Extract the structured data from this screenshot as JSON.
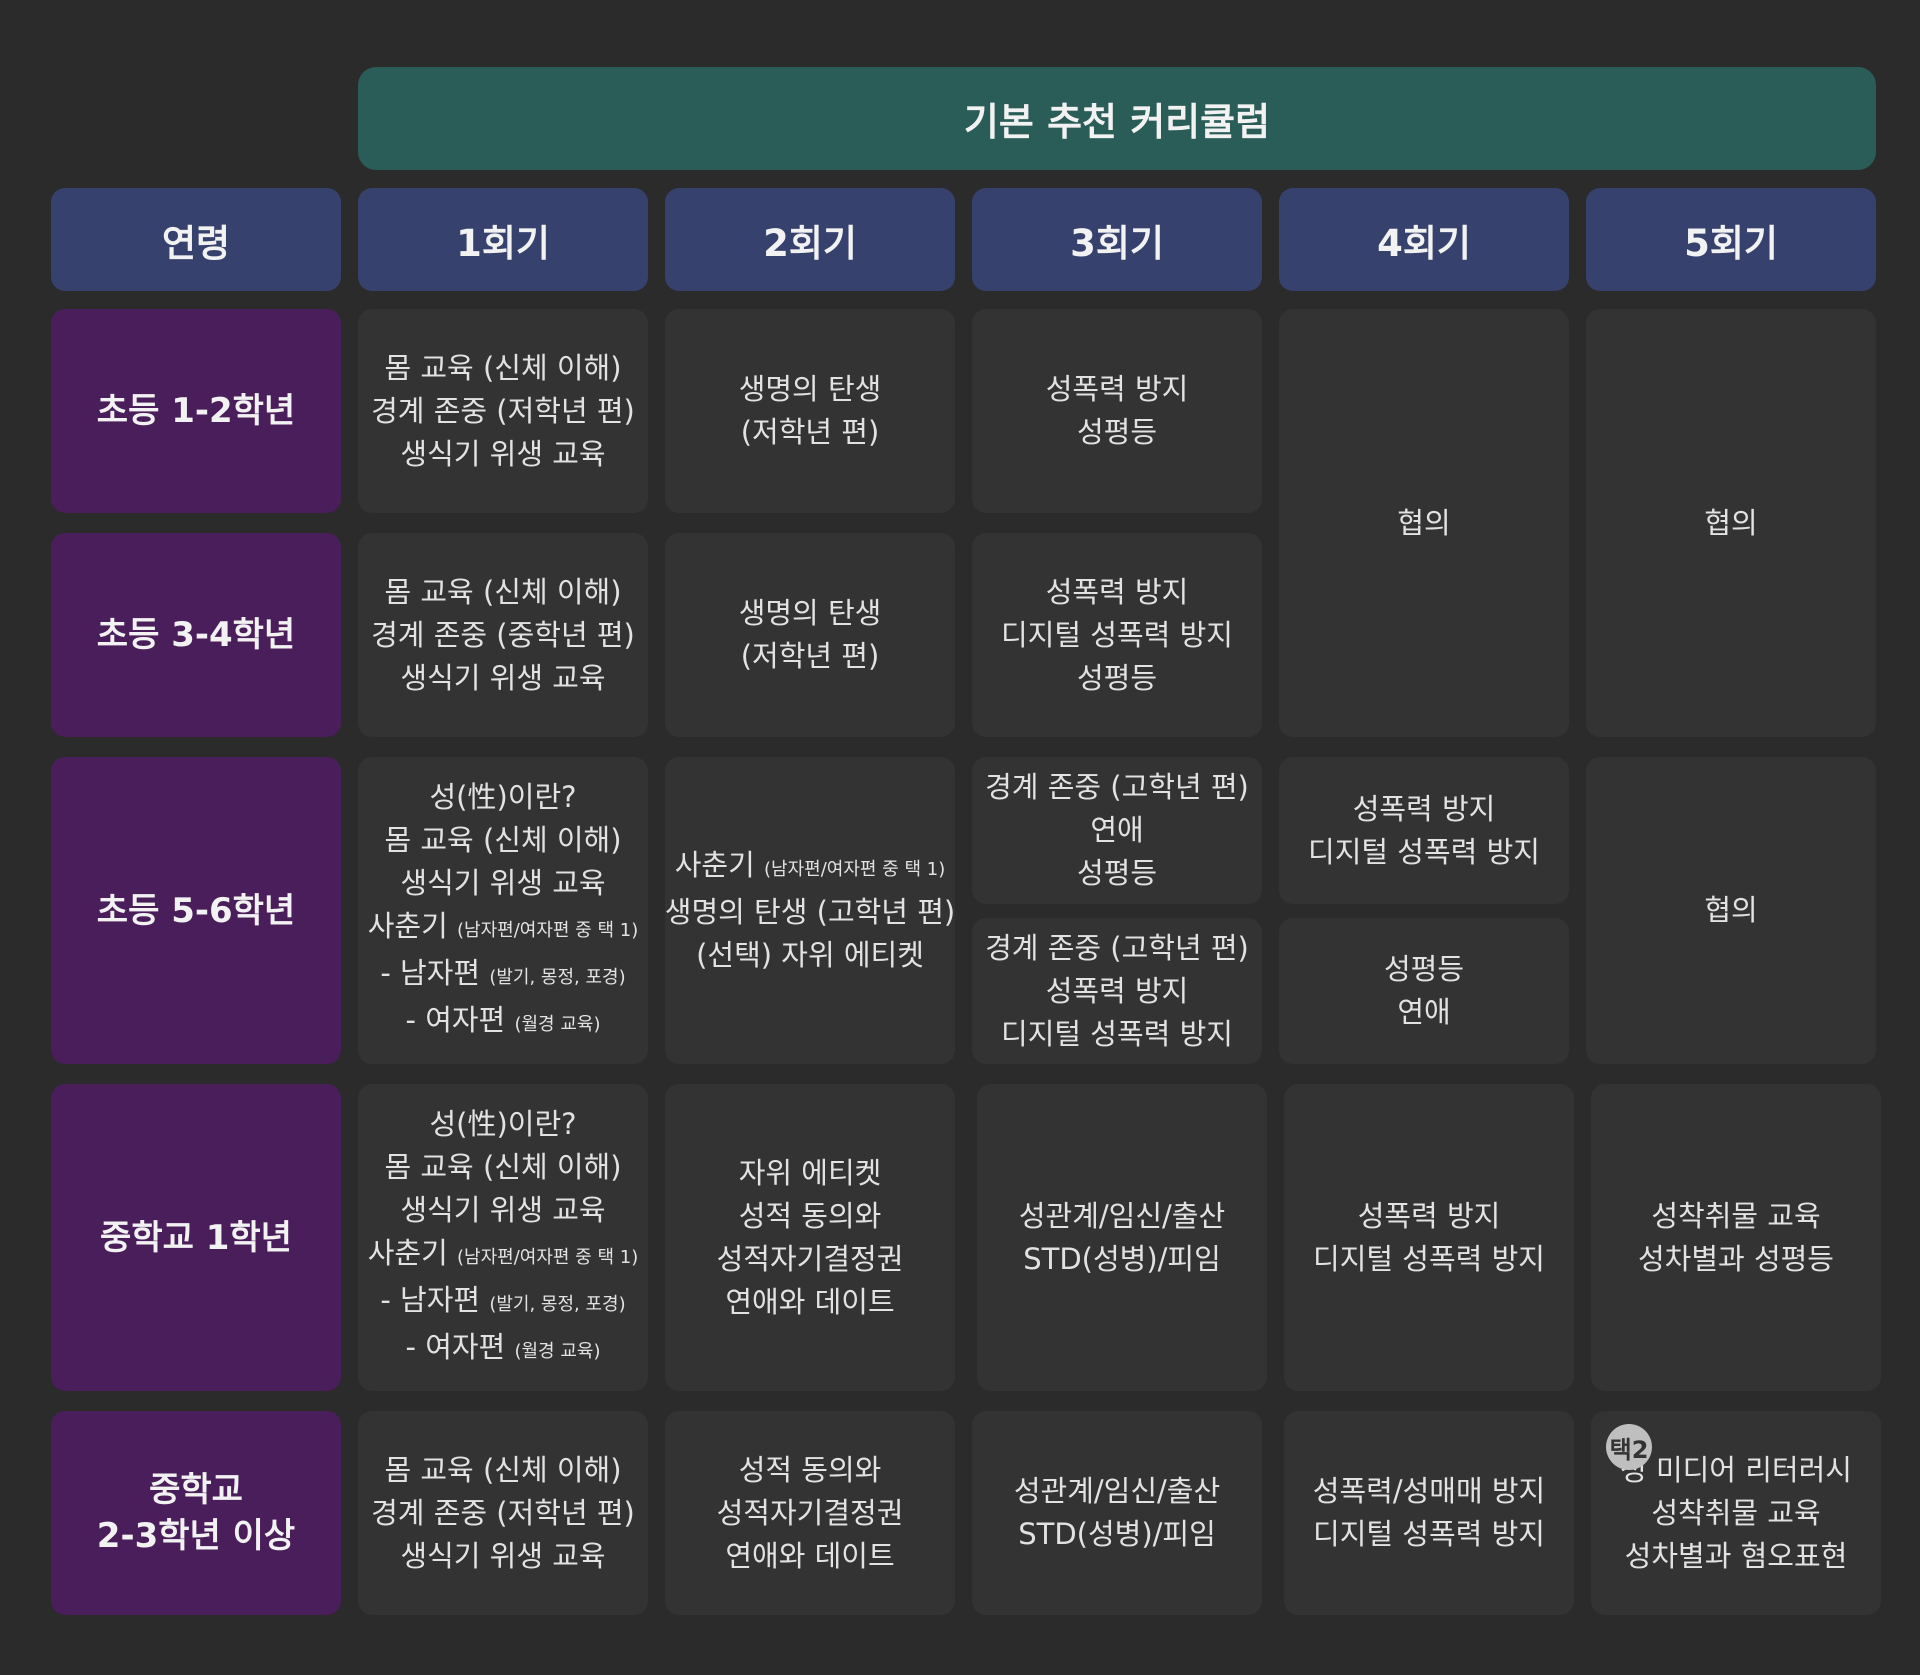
{
  "banner": "기본 추천 커리큘럼",
  "headers": {
    "age": "연령",
    "s1": "1회기",
    "s2": "2회기",
    "s3": "3회기",
    "s4": "4회기",
    "s5": "5회기"
  },
  "ages": {
    "e12": "초등 1-2학년",
    "e34": "초등 3-4학년",
    "e56": "초등 5-6학년",
    "m1": "중학교 1학년",
    "m23_line1": "중학교",
    "m23_line2": "2-3학년 이상"
  },
  "notes": {
    "puberty": "(남자편/여자편 중 택 1)",
    "male": "(발기, 몽정, 포경)",
    "female": "(월경 교육)"
  },
  "cells": {
    "e12_s1": [
      "몸 교육 (신체 이해)",
      "경계 존중 (저학년 편)",
      "생식기 위생 교육"
    ],
    "e12_s2": [
      "생명의 탄생",
      "(저학년 편)"
    ],
    "e12_s3": [
      "성폭력 방지",
      "성평등"
    ],
    "e34_s1": [
      "몸 교육 (신체 이해)",
      "경계 존중 (중학년 편)",
      "생식기 위생 교육"
    ],
    "e34_s2": [
      "생명의 탄생",
      "(저학년 편)"
    ],
    "e34_s3": [
      "성폭력 방지",
      "디지털 성폭력 방지",
      "성평등"
    ],
    "e1234_s4": "협의",
    "e1234_s5": "협의",
    "e56_s1": [
      "성(性)이란?",
      "몸 교육 (신체 이해)",
      "생식기 위생 교육",
      "사춘기",
      "- 남자편",
      "- 여자편"
    ],
    "e56_s2": [
      "사춘기",
      "생명의 탄생 (고학년 편)",
      "(선택) 자위 에티켓"
    ],
    "e56_s3a": [
      "경계 존중 (고학년 편)",
      "연애",
      "성평등"
    ],
    "e56_s3b": [
      "경계 존중 (고학년 편)",
      "성폭력 방지",
      "디지털 성폭력 방지"
    ],
    "e56_s4a": [
      "성폭력 방지",
      "디지털 성폭력 방지"
    ],
    "e56_s4b": [
      "성평등",
      "연애"
    ],
    "e56_s5": "협의",
    "m1_s1": [
      "성(性)이란?",
      "몸 교육 (신체 이해)",
      "생식기 위생 교육",
      "사춘기",
      "- 남자편",
      "- 여자편"
    ],
    "m1_s2": [
      "자위 에티켓",
      "성적 동의와",
      "성적자기결정권",
      "연애와 데이트"
    ],
    "m1_s3": [
      "성관계/임신/출산",
      "STD(성병)/피임"
    ],
    "m1_s4": [
      "성폭력 방지",
      "디지털 성폭력 방지"
    ],
    "m1_s5": [
      "성착취물 교육",
      "성차별과 성평등"
    ],
    "m23_s1": [
      "몸 교육 (신체 이해)",
      "경계 존중 (저학년 편)",
      "생식기 위생 교육"
    ],
    "m23_s2": [
      "성적 동의와",
      "성적자기결정권",
      "연애와 데이트"
    ],
    "m23_s3": [
      "성관계/임신/출산",
      "STD(성병)/피임"
    ],
    "m23_s4": [
      "성폭력/성매매 방지",
      "디지털 성폭력 방지"
    ],
    "m23_s5": [
      "성 미디어 리터러시",
      "성착취물 교육",
      "성차별과 혐오표현"
    ]
  },
  "badge": "택2"
}
